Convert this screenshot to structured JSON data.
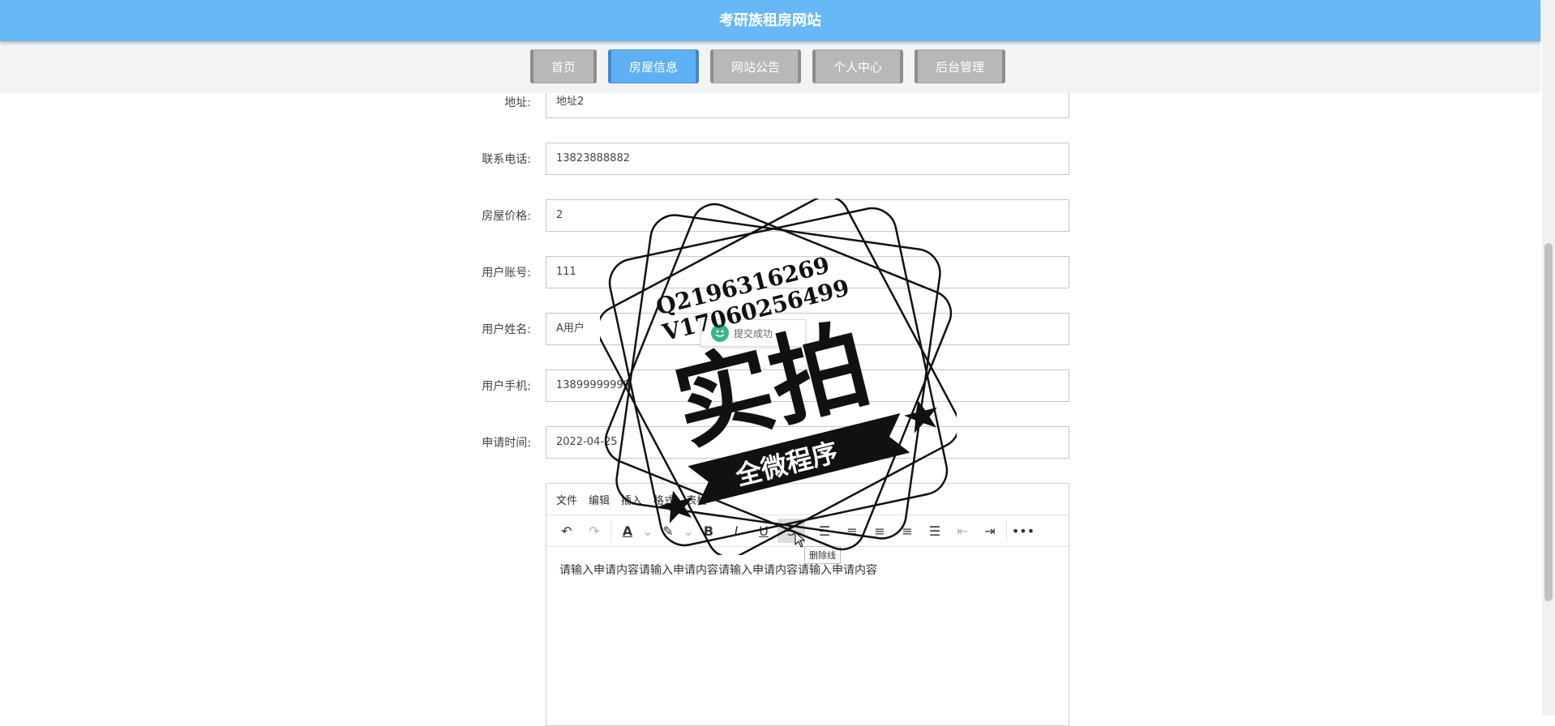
{
  "site_title": "考研族租房网站",
  "nav": [
    {
      "label": "首页",
      "active": false
    },
    {
      "label": "房屋信息",
      "active": true
    },
    {
      "label": "网站公告",
      "active": false
    },
    {
      "label": "个人中心",
      "active": false
    },
    {
      "label": "后台管理",
      "active": false
    }
  ],
  "form": {
    "address": {
      "label": "地址:",
      "value": "地址2"
    },
    "phone": {
      "label": "联系电话:",
      "value": "13823888882"
    },
    "price": {
      "label": "房屋价格:",
      "value": "2"
    },
    "account": {
      "label": "用户账号:",
      "value": "111"
    },
    "username": {
      "label": "用户姓名:",
      "value": "A用户"
    },
    "mobile": {
      "label": "用户手机:",
      "value": "13899999999"
    },
    "apply_time": {
      "label": "申请时间:",
      "value": "2022-04-25"
    }
  },
  "editor": {
    "menus": [
      "文件",
      "编辑",
      "插入",
      "格式",
      "表格"
    ],
    "content": "请输入申请内容请输入申请内容请输入申请内容请输入申请内容",
    "tooltip": "删除线"
  },
  "toast": {
    "text": "提交成功"
  },
  "watermark": {
    "line1": "Q2196316269",
    "line2": "V17060256499",
    "main": "实拍",
    "banner": "全微程序"
  }
}
